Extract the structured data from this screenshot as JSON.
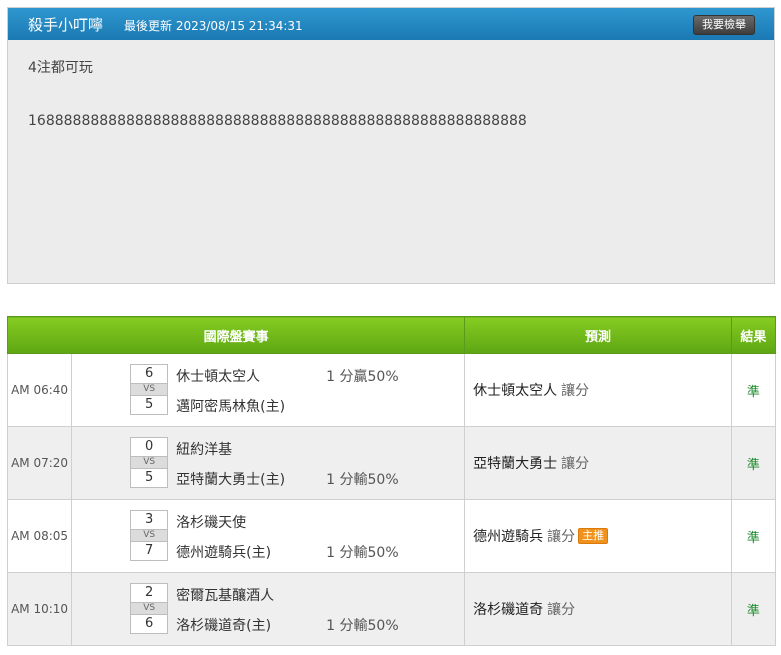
{
  "header": {
    "title": "殺手小叮嚀",
    "updated_label": "最後更新 2023/08/15 21:34:31",
    "report_button": "我要檢舉"
  },
  "note": {
    "line1": "4注都可玩",
    "line2": "16888888888888888888888888888888888888888888888888888888"
  },
  "table": {
    "col_match": "國際盤賽事",
    "col_prediction": "預測",
    "col_result": "結果",
    "vs_label": "VS",
    "rows": [
      {
        "time": "AM 06:40",
        "score_top": "6",
        "score_bot": "5",
        "team_top": "休士頓太空人",
        "team_bot": "邁阿密馬林魚(主)",
        "odds_top": "1 分贏50%",
        "odds_bot": "",
        "pick": "休士頓太空人",
        "pick_type": "讓分",
        "badge": "",
        "result": "準"
      },
      {
        "time": "AM 07:20",
        "score_top": "0",
        "score_bot": "5",
        "team_top": "紐約洋基",
        "team_bot": "亞特蘭大勇士(主)",
        "odds_top": "",
        "odds_bot": "1 分輸50%",
        "pick": "亞特蘭大勇士",
        "pick_type": "讓分",
        "badge": "",
        "result": "準"
      },
      {
        "time": "AM 08:05",
        "score_top": "3",
        "score_bot": "7",
        "team_top": "洛杉磯天使",
        "team_bot": "德州遊騎兵(主)",
        "odds_top": "",
        "odds_bot": "1 分輸50%",
        "pick": "德州遊騎兵",
        "pick_type": "讓分",
        "badge": "主推",
        "result": "準"
      },
      {
        "time": "AM 10:10",
        "score_top": "2",
        "score_bot": "6",
        "team_top": "密爾瓦基釀酒人",
        "team_bot": "洛杉磯道奇(主)",
        "odds_top": "",
        "odds_bot": "1 分輸50%",
        "pick": "洛杉磯道奇",
        "pick_type": "讓分",
        "badge": "",
        "result": "準"
      }
    ]
  },
  "colors": {
    "header_blue": "#1b79b3",
    "table_green": "#6fb81a",
    "badge_orange": "#f0921e",
    "result_green": "#1a8a2a"
  }
}
